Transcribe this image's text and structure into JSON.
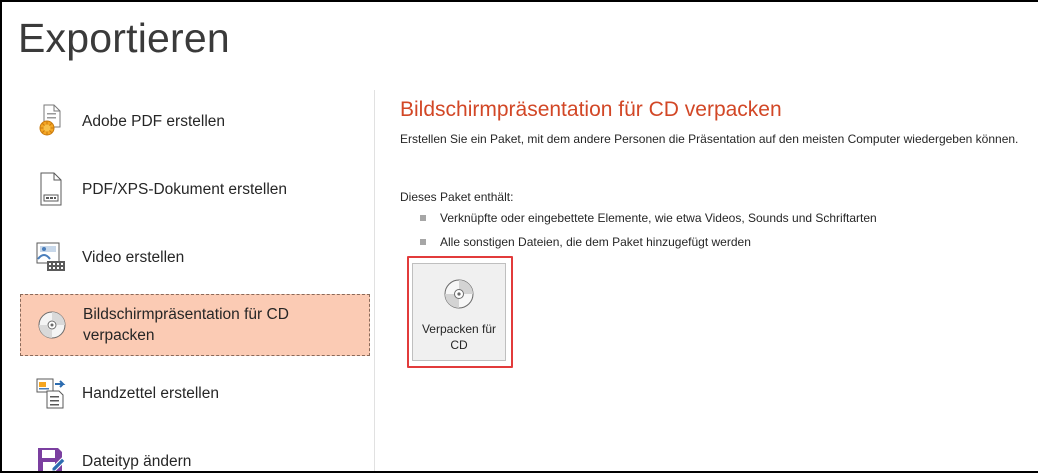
{
  "page": {
    "title": "Exportieren"
  },
  "nav": {
    "items": [
      {
        "label": "Adobe PDF erstellen",
        "icon": "adobe-pdf-icon"
      },
      {
        "label": "PDF/XPS-Dokument erstellen",
        "icon": "pdf-xps-document-icon"
      },
      {
        "label": "Video erstellen",
        "icon": "video-icon"
      },
      {
        "label": "Bildschirmpräsentation für CD verpacken",
        "icon": "cd-package-icon",
        "selected": true
      },
      {
        "label": "Handzettel erstellen",
        "icon": "handout-icon"
      },
      {
        "label": "Dateityp ändern",
        "icon": "save-filetype-icon"
      }
    ]
  },
  "content": {
    "heading": "Bildschirmpräsentation für CD verpacken",
    "description": "Erstellen Sie ein Paket, mit dem andere Personen die Präsentation auf den meisten Computer wiedergeben können.",
    "package_heading": "Dieses Paket enthält:",
    "bullets": [
      "Verknüpfte oder eingebettete Elemente, wie etwa Videos, Sounds und Schriftarten",
      "Alle sonstigen Dateien, die dem Paket hinzugefügt werden"
    ],
    "action_button": {
      "label": "Verpacken für CD",
      "icon": "cd-icon"
    }
  },
  "colors": {
    "accent": "#d24726",
    "selected_bg": "#fbcbb4",
    "highlight_outline": "#e23b3b"
  }
}
